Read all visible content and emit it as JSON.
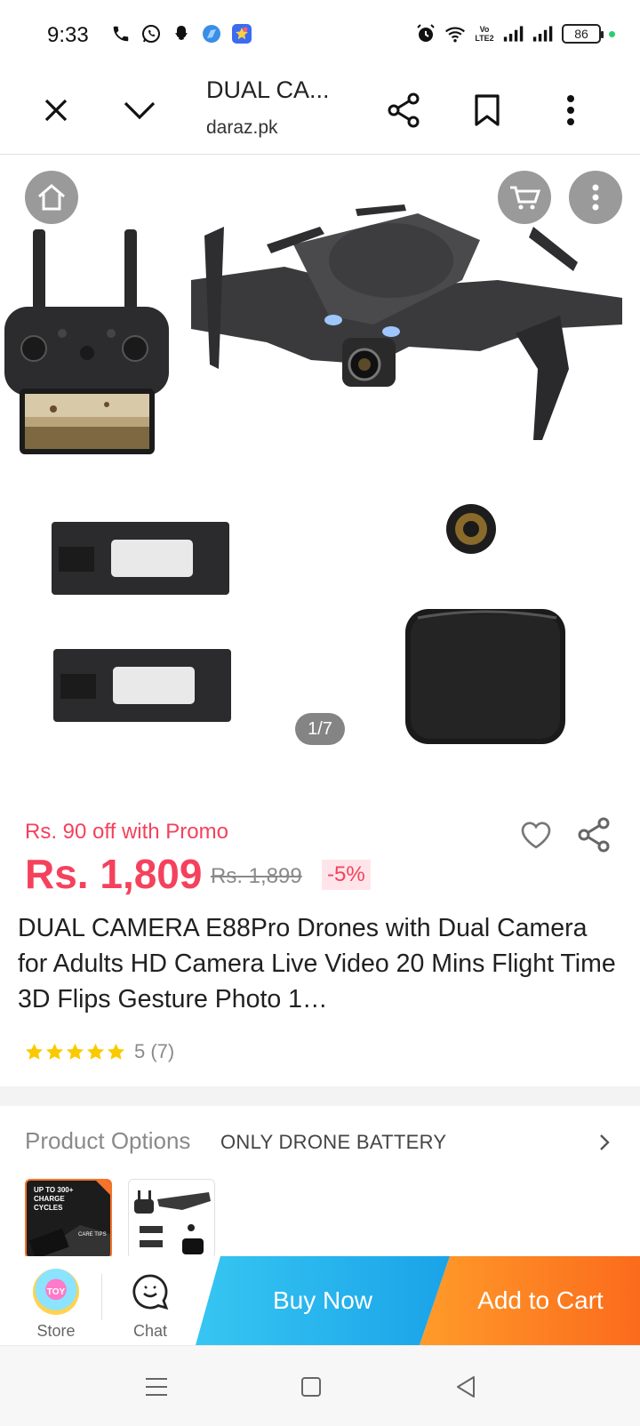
{
  "status_bar": {
    "time": "9:33",
    "battery": "86",
    "network": "Vo LTE2",
    "icons": [
      "phone-icon",
      "whatsapp-icon",
      "snapchat-icon",
      "browser-icon",
      "star-app-icon",
      "alarm-icon",
      "wifi-icon",
      "signal-icon",
      "signal-icon"
    ]
  },
  "browser": {
    "title": "DUAL CA...",
    "url": "daraz.pk",
    "icons": [
      "close-icon",
      "chevron-down-icon",
      "share-icon",
      "bookmark-icon",
      "more-vertical-icon"
    ]
  },
  "gallery": {
    "counter": "1/7",
    "icons": [
      "home-icon",
      "cart-icon",
      "more-vertical-icon"
    ]
  },
  "product": {
    "promo": "Rs. 90 off with Promo",
    "price": "Rs. 1,809",
    "original_price": "Rs. 1,899",
    "discount": "-5%",
    "title": "DUAL CAMERA E88Pro Drones with Dual Camera for Adults HD Camera Live Video 20 Mins Flight Time 3D Flips Gesture Photo 1…",
    "rating_text": "5 (7)",
    "rating_stars": 5,
    "accent_color": "#f5415c"
  },
  "options": {
    "label": "Product Options",
    "value": "ONLY DRONE BATTERY",
    "thumbnail1_text": "UP TO 300+ CHARGE CYCLES",
    "thumbnail1_sub": "CARE TIPS"
  },
  "actions": {
    "store_label": "Store",
    "store_logo_text": "TOY",
    "chat_label": "Chat",
    "buy_now": "Buy Now",
    "add_to_cart": "Add to Cart",
    "buy_color": "#1aa3e8",
    "cart_color": "#fb6b1c"
  },
  "system_nav": {
    "icons": [
      "menu-icon",
      "home-square-icon",
      "back-triangle-icon"
    ]
  }
}
